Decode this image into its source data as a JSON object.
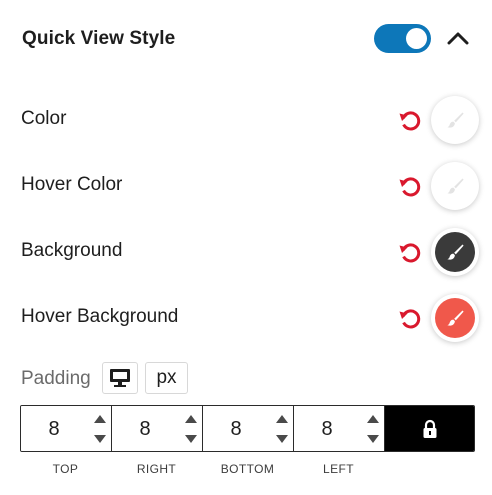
{
  "panel": {
    "title": "Quick View Style",
    "toggle_on": true,
    "toggle_color": "#0d77b9"
  },
  "icons": {
    "collapse": "chevron-up-icon",
    "reset": "reset-icon",
    "picker": "brush-icon",
    "device": "desktop-icon",
    "lock": "lock-icon",
    "spinner_up": "triangle-up-icon",
    "spinner_down": "triangle-down-icon"
  },
  "colors": {
    "reset_icon": "#d9182d",
    "swatch_color": "#ffffff",
    "swatch_hover_color": "#ffffff",
    "swatch_background": "#3a3a3a",
    "swatch_hover_background": "#f0584b"
  },
  "rows": [
    {
      "label": "Color"
    },
    {
      "label": "Hover Color"
    },
    {
      "label": "Background"
    },
    {
      "label": "Hover Background"
    }
  ],
  "padding": {
    "label": "Padding",
    "unit": "px",
    "values": [
      "8",
      "8",
      "8",
      "8"
    ],
    "sides": [
      "TOP",
      "RIGHT",
      "BOTTOM",
      "LEFT"
    ]
  }
}
